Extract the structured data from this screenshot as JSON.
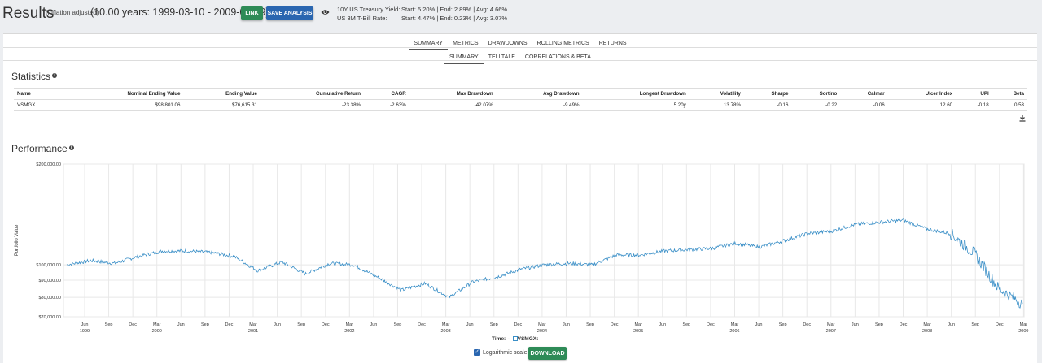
{
  "header": {
    "title": "Results",
    "subtitle": "(inflation adjusted)",
    "range": "(10.00 years: 1999-03-10 - 2009-03-09)",
    "link_label": "LINK",
    "save_label": "SAVE ANALYSIS",
    "rates": [
      {
        "label": "10Y US Treasury Yield:",
        "value": "Start: 5.20%  |  End: 2.89%  |  Avg: 4.66%"
      },
      {
        "label": "US 3M T-Bill Rate:",
        "value": "Start: 4.47%  |  End: 0.23%  |  Avg: 3.07%"
      }
    ]
  },
  "tabs": [
    "SUMMARY",
    "METRICS",
    "DRAWDOWNS",
    "ROLLING METRICS",
    "RETURNS"
  ],
  "subtabs": [
    "SUMMARY",
    "TELLTALE",
    "CORRELATIONS & BETA"
  ],
  "statistics": {
    "title": "Statistics",
    "columns": [
      "Name",
      "Nominal Ending Value",
      "Ending Value",
      "Cumulative Return",
      "CAGR",
      "Max Drawdown",
      "Avg Drawdown",
      "Longest Drawdown",
      "Volatility",
      "Sharpe",
      "Sortino",
      "Calmar",
      "Ulcer Index",
      "UPI",
      "Beta"
    ],
    "rows": [
      [
        "VSMGX",
        "$98,801.06",
        "$76,615.31",
        "-23.38%",
        "-2.63%",
        "-42.07%",
        "-9.49%",
        "5.20y",
        "13.78%",
        "-0.16",
        "-0.22",
        "-0.06",
        "12.60",
        "-0.18",
        "0.53"
      ]
    ]
  },
  "performance": {
    "title": "Performance",
    "legend_time": "Time: –",
    "legend_series": "VSMGX:",
    "log_label": "Logarithmic scale",
    "download_label": "DOWNLOAD"
  },
  "chart_data": {
    "type": "line",
    "ylabel": "Portfolio Value",
    "yscale": "log",
    "ylim": [
      70000,
      200000
    ],
    "yticks": [
      "$70,000.00",
      "$80,000.00",
      "$90,000.00",
      "$100,000.00",
      "$200,000.00"
    ],
    "x_month_ticks": [
      "Jun",
      "Sep",
      "Dec",
      "Mar",
      "Jun",
      "Sep",
      "Dec",
      "Mar",
      "Jun",
      "Sep",
      "Dec",
      "Mar",
      "Jun",
      "Sep",
      "Dec",
      "Mar",
      "Jun",
      "Sep",
      "Dec",
      "Mar",
      "Jun",
      "Sep",
      "Dec",
      "Mar",
      "Jun",
      "Sep",
      "Dec",
      "Mar",
      "Jun",
      "Sep",
      "Dec",
      "Mar",
      "Jun",
      "Sep",
      "Dec",
      "Mar",
      "Jun",
      "Sep",
      "Dec",
      "Mar"
    ],
    "x_year_ticks": [
      "1999",
      "2000",
      "2001",
      "2002",
      "2003",
      "2004",
      "2005",
      "2006",
      "2007",
      "2008",
      "2009"
    ],
    "grid": true,
    "color": "#3a8fc7",
    "series": [
      {
        "name": "VSMGX",
        "x": [
          "1999-03",
          "1999-06",
          "1999-09",
          "1999-12",
          "2000-03",
          "2000-06",
          "2000-09",
          "2000-12",
          "2001-03",
          "2001-06",
          "2001-09",
          "2001-12",
          "2002-03",
          "2002-06",
          "2002-09",
          "2002-12",
          "2003-03",
          "2003-06",
          "2003-09",
          "2003-12",
          "2004-03",
          "2004-06",
          "2004-09",
          "2004-12",
          "2005-03",
          "2005-06",
          "2005-09",
          "2005-12",
          "2006-03",
          "2006-06",
          "2006-09",
          "2006-12",
          "2007-03",
          "2007-06",
          "2007-09",
          "2007-12",
          "2008-03",
          "2008-06",
          "2008-09",
          "2008-12",
          "2009-03"
        ],
        "values": [
          100000,
          103000,
          101000,
          106000,
          110000,
          110000,
          109000,
          106000,
          96000,
          102000,
          94000,
          101000,
          100000,
          92000,
          84000,
          88000,
          80000,
          89000,
          92000,
          97000,
          100000,
          101000,
          100000,
          107000,
          107000,
          110000,
          111000,
          112000,
          116000,
          113000,
          118000,
          124000,
          126000,
          132000,
          134000,
          136000,
          128000,
          124000,
          108000,
          85000,
          76600
        ]
      }
    ]
  }
}
